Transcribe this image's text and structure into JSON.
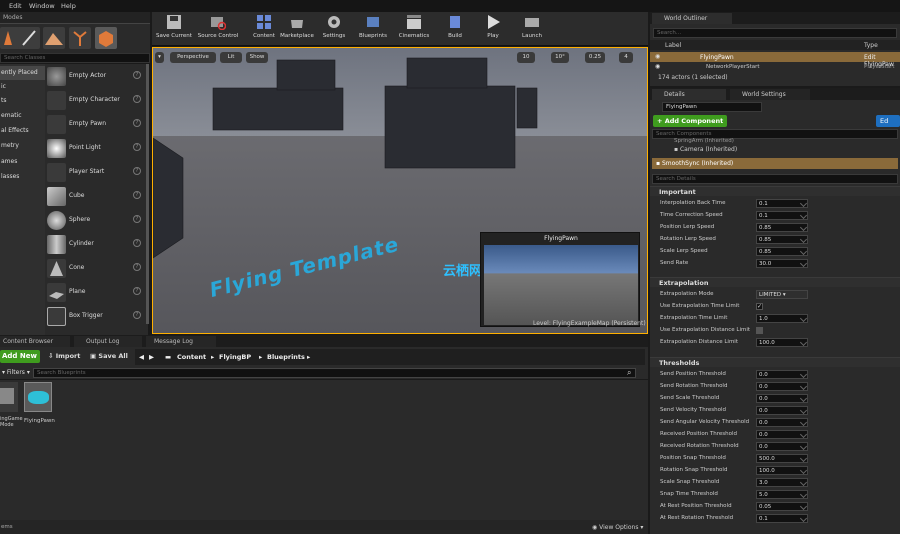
{
  "menu": {
    "items": [
      "Edit",
      "Window",
      "Help"
    ]
  },
  "modes": {
    "tab_label": "Modes",
    "search_placeholder": "Search Classes",
    "categories": [
      "ently Placed",
      "ic",
      "ts",
      "ematic",
      "al Effects",
      "metry",
      "ames",
      "lasses"
    ],
    "classes": [
      "Empty Actor",
      "Empty Character",
      "Empty Pawn",
      "Point Light",
      "Player Start",
      "Cube",
      "Sphere",
      "Cylinder",
      "Cone",
      "Plane",
      "Box Trigger"
    ]
  },
  "toolbar": {
    "buttons": [
      "Save Current",
      "Source Control",
      "Content",
      "Marketplace",
      "Settings",
      "Blueprints",
      "Cinematics",
      "Build",
      "Play",
      "Launch"
    ]
  },
  "viewport": {
    "perspective": "Perspective",
    "lit": "Lit",
    "show": "Show",
    "grid_snap": "10",
    "rot_snap": "10°",
    "scale_snap": "0.25",
    "cam_speed": "4",
    "scene_text": "Flying Template",
    "watermark": "云栖网络",
    "pip_title": "FlyingPawn",
    "level_label": "Level:  FlyingExampleMap (Persistent)"
  },
  "bottom": {
    "tabs": [
      "Content Browser",
      "Output Log",
      "Message Log"
    ],
    "add_new": "Add New",
    "import": "Import",
    "save_all": "Save All",
    "breadcrumbs": [
      "Content",
      "FlyingBP",
      "Blueprints"
    ],
    "filters": "Filters",
    "search_placeholder": "Search Blueprints",
    "assets": [
      {
        "name": "ingGame\nMode"
      },
      {
        "name": "FlyingPawn"
      }
    ],
    "status_left": "ems",
    "view_options": "View Options"
  },
  "outliner": {
    "tab": "World Outliner",
    "search_placeholder": "Search...",
    "col_label": "Label",
    "col_type": "Type",
    "rows": [
      {
        "label": "FlyingPawn",
        "type": "Edit FlyingPaw"
      },
      {
        "label": "NetworkPlayerStart",
        "type": "PlayerStart"
      }
    ],
    "count": "174 actors (1 selected)"
  },
  "details": {
    "tab": "Details",
    "tab2": "World Settings",
    "name_value": "FlyingPawn",
    "add_component": "+ Add Component",
    "edit_button": "Ed",
    "search_components_placeholder": "Search Components",
    "components": [
      "SpringArm (Inherited)",
      "Camera (Inherited)",
      "SmoothSync (Inherited)"
    ],
    "search_details_placeholder": "Search Details",
    "sections": {
      "important": {
        "title": "Important",
        "rows": [
          {
            "label": "Interpolation Back Time",
            "value": "0.1"
          },
          {
            "label": "Time Correction Speed",
            "value": "0.1"
          },
          {
            "label": "Position Lerp Speed",
            "value": "0.85"
          },
          {
            "label": "Rotation Lerp Speed",
            "value": "0.85"
          },
          {
            "label": "Scale Lerp Speed",
            "value": "0.85"
          },
          {
            "label": "Send Rate",
            "value": "30.0"
          }
        ]
      },
      "extrapolation": {
        "title": "Extrapolation",
        "mode_label": "Extrapolation Mode",
        "mode_value": "LIMITED",
        "use_time_label": "Use Extrapolation Time Limit",
        "use_time_checked": "✓",
        "time_limit_label": "Extrapolation Time Limit",
        "time_limit_value": "1.0",
        "use_dist_label": "Use Extrapolation Distance Limit",
        "dist_limit_label": "Extrapolation Distance Limit",
        "dist_limit_value": "100.0"
      },
      "thresholds": {
        "title": "Thresholds",
        "rows": [
          {
            "label": "Send Position Threshold",
            "value": "0.0"
          },
          {
            "label": "Send Rotation Threshold",
            "value": "0.0"
          },
          {
            "label": "Send Scale Threshold",
            "value": "0.0"
          },
          {
            "label": "Send Velocity Threshold",
            "value": "0.0"
          },
          {
            "label": "Send Angular Velocity Threshold",
            "value": "0.0"
          },
          {
            "label": "Received Position Threshold",
            "value": "0.0"
          },
          {
            "label": "Received Rotation Threshold",
            "value": "0.0"
          },
          {
            "label": "Position Snap Threshold",
            "value": "500.0"
          },
          {
            "label": "Rotation Snap Threshold",
            "value": "100.0"
          },
          {
            "label": "Scale Snap Threshold",
            "value": "3.0"
          },
          {
            "label": "Snap Time Threshold",
            "value": "5.0"
          },
          {
            "label": "At Rest Position Threshold",
            "value": "0.05"
          },
          {
            "label": "At Rest Rotation Threshold",
            "value": "0.1"
          }
        ]
      }
    }
  },
  "colors": {
    "accent_green": "#3f9c1e",
    "accent_blue": "#2aa7d8",
    "selection": "#8a6a3a"
  }
}
